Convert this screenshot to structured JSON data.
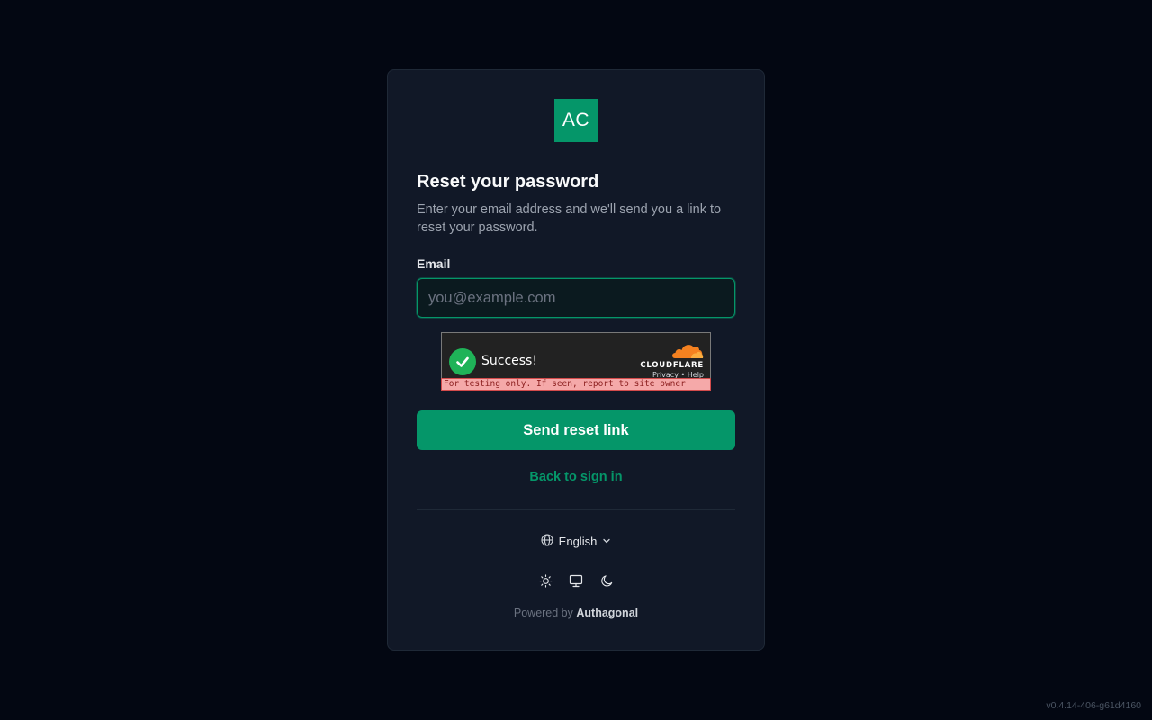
{
  "brand": {
    "logo_text": "AC",
    "accent": "#059669"
  },
  "form": {
    "title": "Reset your password",
    "subtitle": "Enter your email address and we'll send you a link to reset your password.",
    "email_label": "Email",
    "email_placeholder": "you@example.com",
    "email_value": "",
    "submit_label": "Send reset link",
    "back_link": "Back to sign in"
  },
  "captcha": {
    "status": "Success!",
    "provider": "CLOUDFLARE",
    "privacy_link": "Privacy",
    "separator": "•",
    "help_link": "Help",
    "warning": "For testing only. If seen, report to site owner"
  },
  "footer": {
    "language": "English",
    "language_icon": "globe-icon",
    "theme_options": [
      "sun-icon",
      "monitor-icon",
      "moon-icon"
    ],
    "powered_prefix": "Powered by",
    "powered_brand": "Authagonal"
  },
  "version": "v0.4.14-406-g61d4160"
}
